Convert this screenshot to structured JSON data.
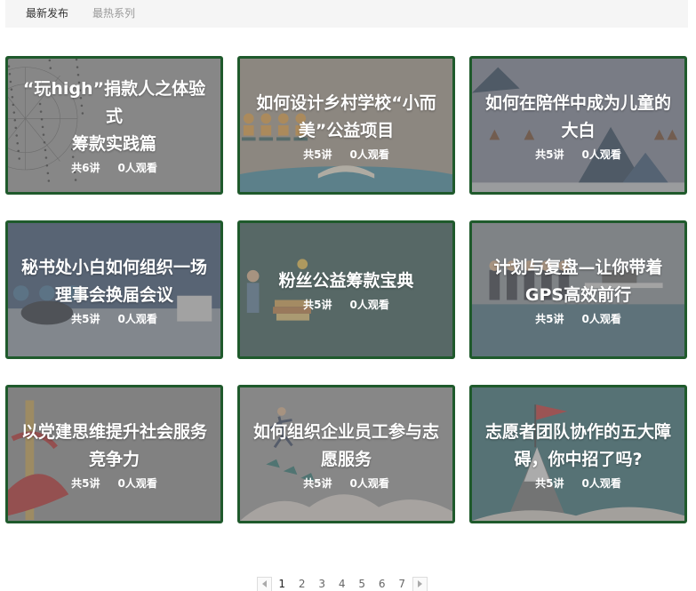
{
  "tabs": [
    {
      "label": "最新发布",
      "active": true
    },
    {
      "label": "最热系列",
      "active": false
    }
  ],
  "courses": [
    {
      "title_lines": [
        "“玩high”捐款人之体验式",
        "筹款实践篇"
      ],
      "lessons": "共6讲",
      "views": "0人观看",
      "art": "network"
    },
    {
      "title_lines": [
        "如何设计乡村学校“小而",
        "美”公益项目"
      ],
      "lessons": "共5讲",
      "views": "0人观看",
      "art": "classroom"
    },
    {
      "title_lines": [
        "如何在陪伴中成为儿童的",
        "大白"
      ],
      "lessons": "共5讲",
      "views": "0人观看",
      "art": "mountains"
    },
    {
      "title_lines": [
        "秘书处小白如何组织一场",
        "理事会换届会议"
      ],
      "lessons": "共5讲",
      "views": "0人观看",
      "art": "meeting"
    },
    {
      "title_lines": [
        "粉丝公益筹款宝典"
      ],
      "lessons": "共5讲",
      "views": "0人观看",
      "art": "books"
    },
    {
      "title_lines": [
        "计划与复盘—让你带着",
        "GPS高效前行"
      ],
      "lessons": "共5讲",
      "views": "0人观看",
      "art": "office"
    },
    {
      "title_lines": [
        "以党建思维提升社会服务",
        "竞争力"
      ],
      "lessons": "共5讲",
      "views": "0人观看",
      "art": "pillar"
    },
    {
      "title_lines": [
        "如何组织企业员工参与志",
        "愿服务"
      ],
      "lessons": "共5讲",
      "views": "0人观看",
      "art": "runner"
    },
    {
      "title_lines": [
        "志愿者团队协作的五大障",
        "碍，你中招了吗?"
      ],
      "lessons": "共5讲",
      "views": "0人观看",
      "art": "summit"
    }
  ],
  "pagination": {
    "pages": [
      "1",
      "2",
      "3",
      "4",
      "5",
      "6",
      "7"
    ],
    "current": "1",
    "prev_icon": "triangle-left-icon",
    "next_icon": "triangle-right-icon"
  },
  "colors": {
    "card_border": "#1f5a2c",
    "overlay": "#808080",
    "tab_bar": "#f5f5f5",
    "text_light": "#ffffff"
  }
}
